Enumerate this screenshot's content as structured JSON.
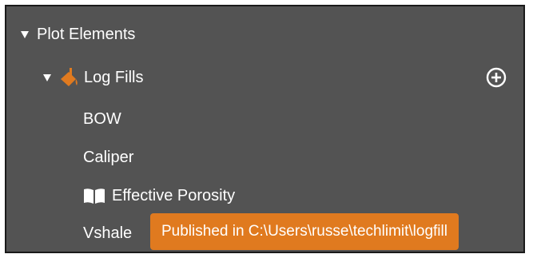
{
  "tree": {
    "root": {
      "label": "Plot Elements",
      "icon": "triangle-down-icon"
    },
    "group": {
      "label": "Log Fills",
      "icon": "paint-bucket-icon",
      "add_icon": "plus-circle-icon",
      "expanded_icon": "triangle-down-icon"
    },
    "items": [
      {
        "label": "BOW"
      },
      {
        "label": "Caliper"
      },
      {
        "label": "Effective Porosity",
        "icon": "open-book-icon"
      },
      {
        "label": "Vshale"
      }
    ]
  },
  "tooltip": {
    "text": "Published in C:\\Users\\russe\\techlimit\\logfill"
  },
  "colors": {
    "panel_background": "#535353",
    "text": "#ffffff",
    "accent_orange": "#e07a1f",
    "frame_border": "#1a1a1a"
  }
}
